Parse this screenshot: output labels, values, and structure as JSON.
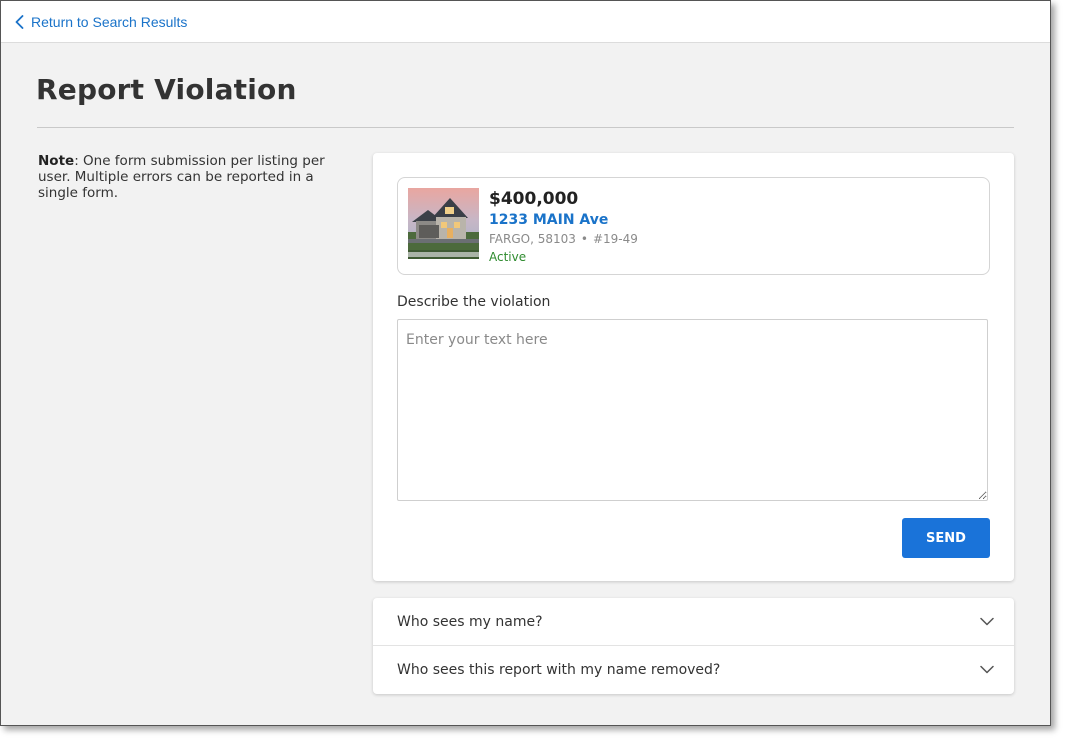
{
  "nav": {
    "back_label": "Return to Search Results"
  },
  "page": {
    "title": "Report Violation"
  },
  "note": {
    "label": "Note",
    "text": ": One form submission per listing per user. Multiple errors can be reported in a single form."
  },
  "listing": {
    "price": "$400,000",
    "address": "1233 MAIN Ave",
    "city_zip": "FARGO, 58103",
    "separator": "•",
    "mls_number": "#19-49",
    "status": "Active",
    "status_color": "#2e8b2e",
    "image_icon": "house-photo"
  },
  "form": {
    "label": "Describe the violation",
    "placeholder": "Enter your text here",
    "value": "",
    "send_label": "SEND"
  },
  "faq": [
    {
      "question": "Who sees my name?",
      "icon": "chevron-down-icon"
    },
    {
      "question": "Who sees this report with my name removed?",
      "icon": "chevron-down-icon"
    }
  ],
  "colors": {
    "accent": "#1a73d9",
    "link": "#1a73c9",
    "background": "#f2f2f2"
  }
}
